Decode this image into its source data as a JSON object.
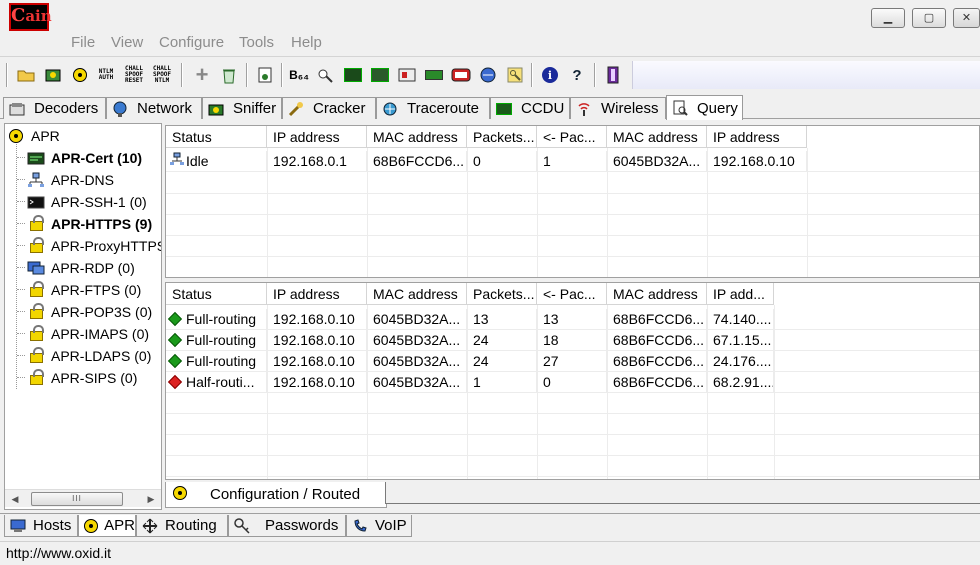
{
  "app": {
    "logo_text": "ain",
    "logo_c": "C"
  },
  "window_buttons": {
    "minimize": "▁",
    "maximize": "▢",
    "close": "✕"
  },
  "menu": [
    "File",
    "View",
    "Configure",
    "Tools",
    "Help"
  ],
  "toolbar": {
    "ntlm_auth": "NTLM\nAUTH",
    "chall_spoof_reset": "CHALL\nSPOOF\nRESET",
    "chall_spoof_ntlm": "CHALL\nSPOOF\nNTLM",
    "b64": "B₆₄"
  },
  "tabs": [
    "Decoders",
    "Network",
    "Sniffer",
    "Cracker",
    "Traceroute",
    "CCDU",
    "Wireless",
    "Query"
  ],
  "tree": {
    "root": "APR",
    "items": [
      {
        "label": "APR-Cert (10)",
        "bold": true
      },
      {
        "label": "APR-DNS",
        "bold": false
      },
      {
        "label": "APR-SSH-1 (0)",
        "bold": false
      },
      {
        "label": "APR-HTTPS (9)",
        "bold": true
      },
      {
        "label": "APR-ProxyHTTPS",
        "bold": false
      },
      {
        "label": "APR-RDP (0)",
        "bold": false
      },
      {
        "label": "APR-FTPS (0)",
        "bold": false
      },
      {
        "label": "APR-POP3S (0)",
        "bold": false
      },
      {
        "label": "APR-IMAPS (0)",
        "bold": false
      },
      {
        "label": "APR-LDAPS (0)",
        "bold": false
      },
      {
        "label": "APR-SIPS (0)",
        "bold": false
      }
    ],
    "scroll_thumb": "III"
  },
  "top_grid": {
    "headers": [
      "Status",
      "IP address",
      "MAC address",
      "Packets...",
      "<- Pac...",
      "MAC address",
      "IP address"
    ],
    "rows": [
      [
        "Idle",
        "192.168.0.1",
        "68B6FCCD6...",
        "0",
        "1",
        "6045BD32A...",
        "192.168.0.10"
      ]
    ]
  },
  "bottom_grid": {
    "headers": [
      "Status",
      "IP address",
      "MAC address",
      "Packets...",
      "<- Pac...",
      "MAC address",
      "IP add..."
    ],
    "rows": [
      [
        "Full-routing",
        "192.168.0.10",
        "6045BD32A...",
        "13",
        "13",
        "68B6FCCD6...",
        "74.140...."
      ],
      [
        "Full-routing",
        "192.168.0.10",
        "6045BD32A...",
        "24",
        "18",
        "68B6FCCD6...",
        "67.1.15..."
      ],
      [
        "Full-routing",
        "192.168.0.10",
        "6045BD32A...",
        "24",
        "27",
        "68B6FCCD6...",
        "24.176...."
      ],
      [
        "Half-routi...",
        "192.168.0.10",
        "6045BD32A...",
        "1",
        "0",
        "68B6FCCD6...",
        "68.2.91...."
      ]
    ]
  },
  "config_tab": "Configuration / Routed",
  "bottom_tabs": [
    "Hosts",
    "APR",
    "Routing",
    "Passwords",
    "VoIP"
  ],
  "status_text": "http://www.oxid.it"
}
